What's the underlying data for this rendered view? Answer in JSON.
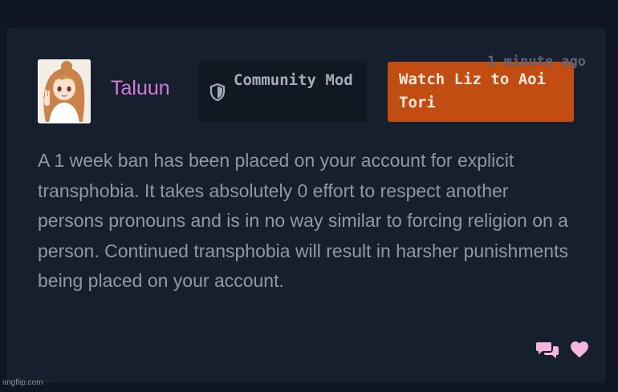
{
  "comment": {
    "username": "Taluun",
    "role_badge": {
      "icon": "shield-icon",
      "label": "Community Mod"
    },
    "action_button": {
      "label": "Watch Liz to Aoi Tori"
    },
    "timestamp": "1 minute ago",
    "message": "A 1 week ban has been placed on your account for explicit transphobia. It takes absolutely 0 effort to respect another persons pronouns and is in no way similar to forcing religion on a person. Continued transphobia will result in harsher punishments being placed on your account.",
    "footer_icons": [
      "comments-icon",
      "heart-icon"
    ]
  },
  "watermark": "imgflip.com",
  "colors": {
    "background": "#0f1621",
    "card": "#161f2d",
    "username": "#d77bd8",
    "action_button": "#c14d12",
    "icon_pink": "#f4b5e0"
  }
}
